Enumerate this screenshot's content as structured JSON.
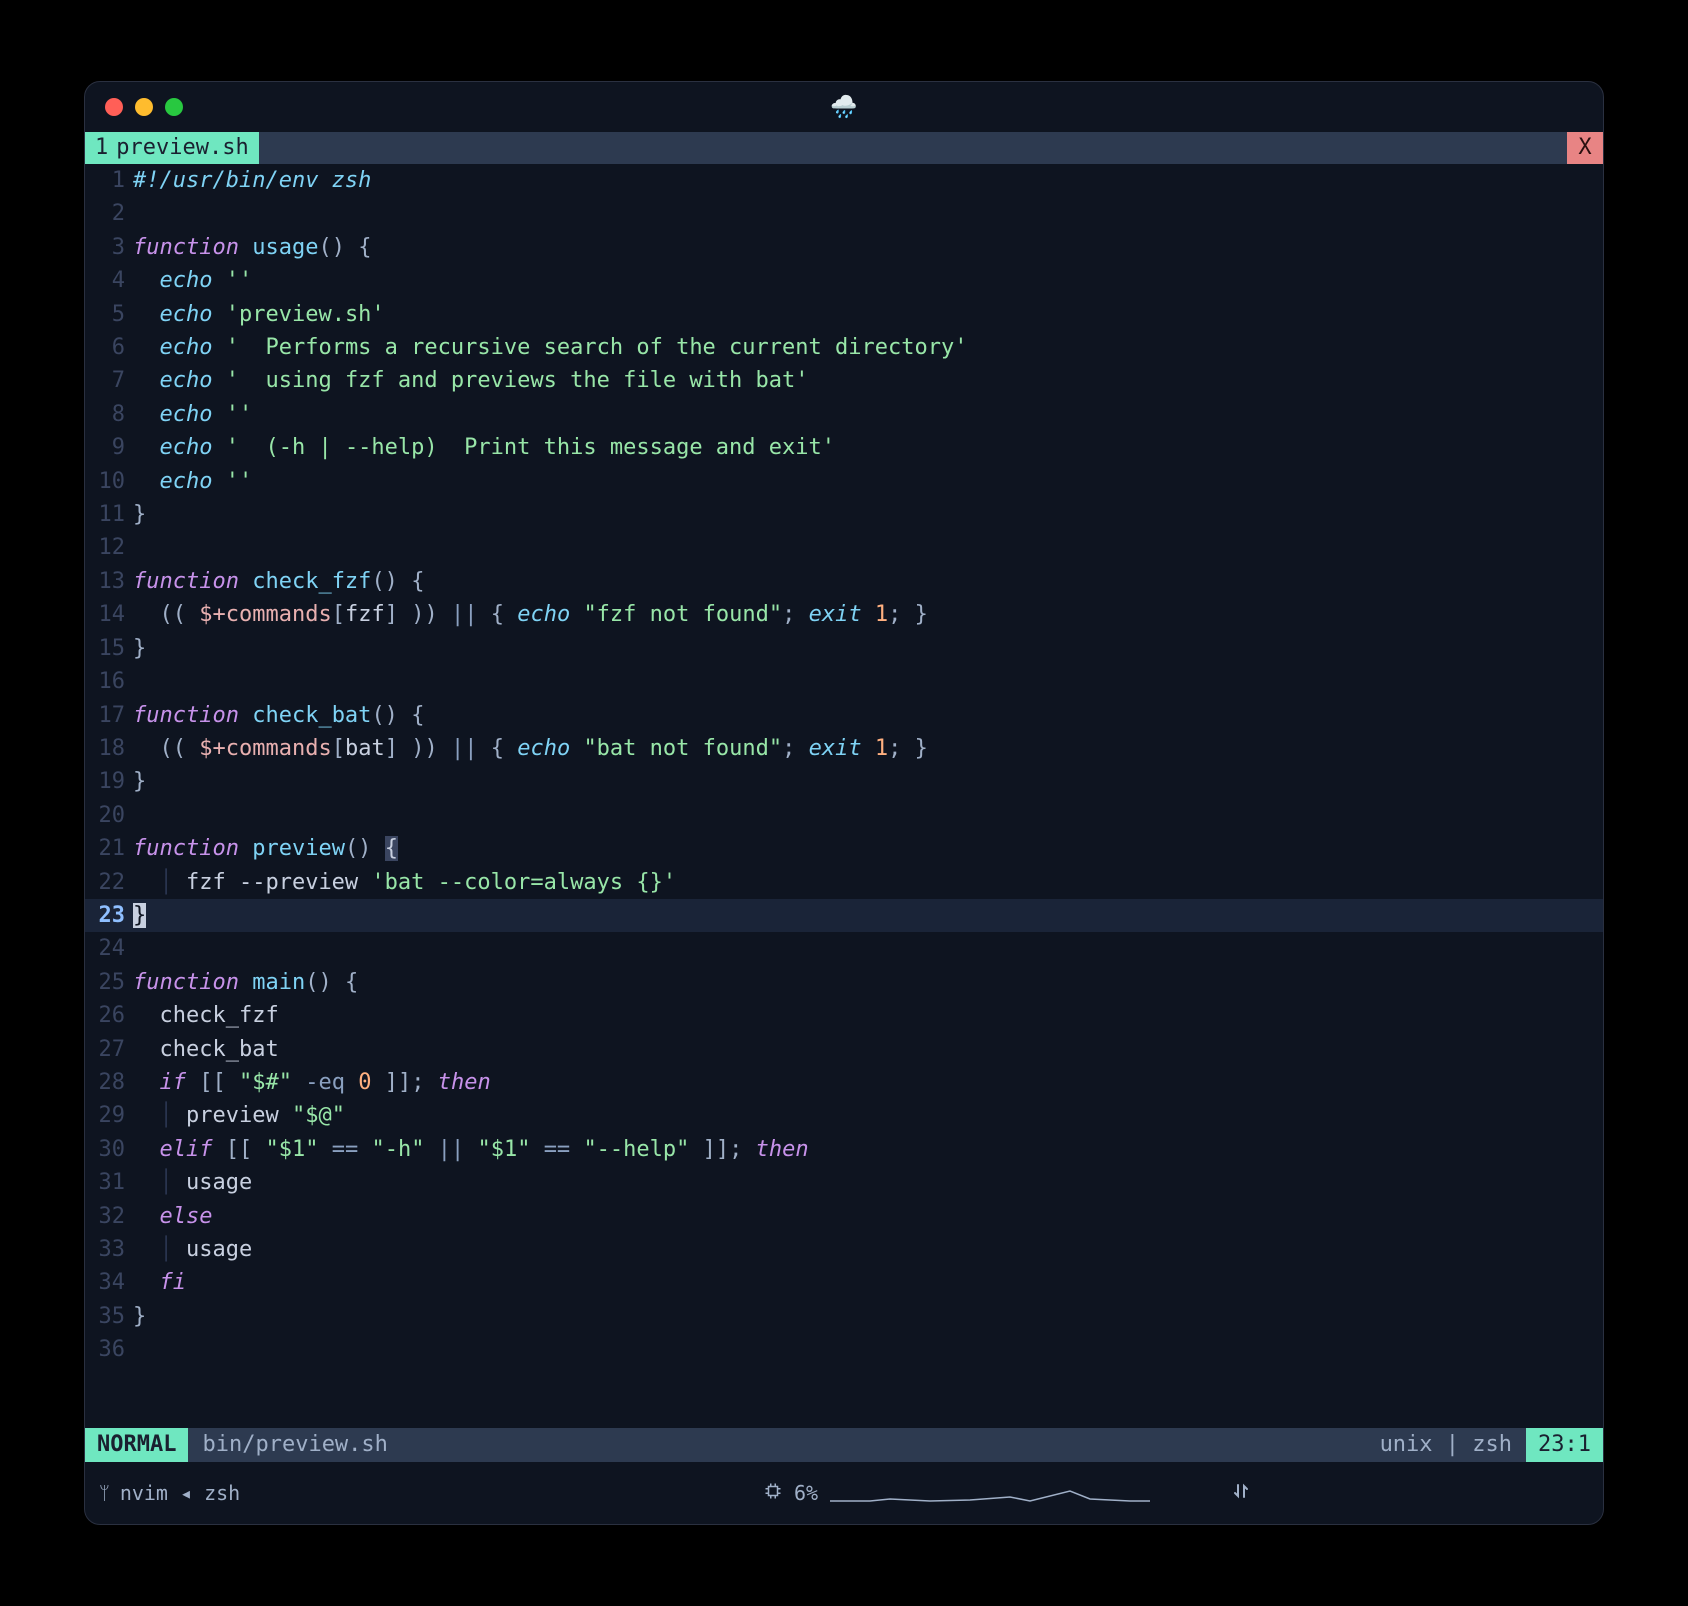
{
  "window": {
    "title_emoji": "🌧️"
  },
  "tabline": {
    "number": "1",
    "filename": "preview.sh",
    "close": "X"
  },
  "lines": [
    {
      "n": "1",
      "segs": [
        [
          "shebang",
          "#!"
        ],
        [
          "shebang",
          "/usr/bin/env zsh"
        ]
      ]
    },
    {
      "n": "2",
      "segs": []
    },
    {
      "n": "3",
      "segs": [
        [
          "keyword",
          "function"
        ],
        [
          "w",
          " "
        ],
        [
          "func",
          "usage"
        ],
        [
          "punct",
          "()"
        ],
        [
          "w",
          " "
        ],
        [
          "punct",
          "{"
        ]
      ]
    },
    {
      "n": "4",
      "segs": [
        [
          "indent",
          "  "
        ],
        [
          "builtin",
          "echo"
        ],
        [
          "w",
          " "
        ],
        [
          "string",
          "''"
        ]
      ]
    },
    {
      "n": "5",
      "segs": [
        [
          "indent",
          "  "
        ],
        [
          "builtin",
          "echo"
        ],
        [
          "w",
          " "
        ],
        [
          "string",
          "'preview.sh'"
        ]
      ]
    },
    {
      "n": "6",
      "segs": [
        [
          "indent",
          "  "
        ],
        [
          "builtin",
          "echo"
        ],
        [
          "w",
          " "
        ],
        [
          "string",
          "'  Performs a recursive search of the current directory'"
        ]
      ]
    },
    {
      "n": "7",
      "segs": [
        [
          "indent",
          "  "
        ],
        [
          "builtin",
          "echo"
        ],
        [
          "w",
          " "
        ],
        [
          "string",
          "'  using fzf and previews the file with bat'"
        ]
      ]
    },
    {
      "n": "8",
      "segs": [
        [
          "indent",
          "  "
        ],
        [
          "builtin",
          "echo"
        ],
        [
          "w",
          " "
        ],
        [
          "string",
          "''"
        ]
      ]
    },
    {
      "n": "9",
      "segs": [
        [
          "indent",
          "  "
        ],
        [
          "builtin",
          "echo"
        ],
        [
          "w",
          " "
        ],
        [
          "string",
          "'  (-h | --help)  Print this message and exit'"
        ]
      ]
    },
    {
      "n": "10",
      "segs": [
        [
          "indent",
          "  "
        ],
        [
          "builtin",
          "echo"
        ],
        [
          "w",
          " "
        ],
        [
          "string",
          "''"
        ]
      ]
    },
    {
      "n": "11",
      "segs": [
        [
          "punct",
          "}"
        ]
      ]
    },
    {
      "n": "12",
      "segs": []
    },
    {
      "n": "13",
      "segs": [
        [
          "keyword",
          "function"
        ],
        [
          "w",
          " "
        ],
        [
          "func",
          "check_fzf"
        ],
        [
          "punct",
          "()"
        ],
        [
          "w",
          " "
        ],
        [
          "punct",
          "{"
        ]
      ]
    },
    {
      "n": "14",
      "segs": [
        [
          "indent",
          "  "
        ],
        [
          "punct",
          "(( "
        ],
        [
          "var",
          "$+commands"
        ],
        [
          "punct",
          "["
        ],
        [
          "plain",
          "fzf"
        ],
        [
          "punct",
          "]"
        ],
        [
          "punct",
          " ))"
        ],
        [
          "w",
          " "
        ],
        [
          "op",
          "||"
        ],
        [
          "w",
          " "
        ],
        [
          "punct",
          "{ "
        ],
        [
          "builtin",
          "echo"
        ],
        [
          "w",
          " "
        ],
        [
          "string",
          "\"fzf not found\""
        ],
        [
          "punct",
          "; "
        ],
        [
          "builtin",
          "exit"
        ],
        [
          "w",
          " "
        ],
        [
          "num",
          "1"
        ],
        [
          "punct",
          "; }"
        ]
      ]
    },
    {
      "n": "15",
      "segs": [
        [
          "punct",
          "}"
        ]
      ]
    },
    {
      "n": "16",
      "segs": []
    },
    {
      "n": "17",
      "segs": [
        [
          "keyword",
          "function"
        ],
        [
          "w",
          " "
        ],
        [
          "func",
          "check_bat"
        ],
        [
          "punct",
          "()"
        ],
        [
          "w",
          " "
        ],
        [
          "punct",
          "{"
        ]
      ]
    },
    {
      "n": "18",
      "segs": [
        [
          "indent",
          "  "
        ],
        [
          "punct",
          "(( "
        ],
        [
          "var",
          "$+commands"
        ],
        [
          "punct",
          "["
        ],
        [
          "plain",
          "bat"
        ],
        [
          "punct",
          "]"
        ],
        [
          "punct",
          " ))"
        ],
        [
          "w",
          " "
        ],
        [
          "op",
          "||"
        ],
        [
          "w",
          " "
        ],
        [
          "punct",
          "{ "
        ],
        [
          "builtin",
          "echo"
        ],
        [
          "w",
          " "
        ],
        [
          "string",
          "\"bat not found\""
        ],
        [
          "punct",
          "; "
        ],
        [
          "builtin",
          "exit"
        ],
        [
          "w",
          " "
        ],
        [
          "num",
          "1"
        ],
        [
          "punct",
          "; }"
        ]
      ]
    },
    {
      "n": "19",
      "segs": [
        [
          "punct",
          "}"
        ]
      ]
    },
    {
      "n": "20",
      "segs": []
    },
    {
      "n": "21",
      "segs": [
        [
          "keyword",
          "function"
        ],
        [
          "w",
          " "
        ],
        [
          "func",
          "preview"
        ],
        [
          "punct",
          "()"
        ],
        [
          "w",
          " "
        ],
        [
          "match",
          "{"
        ]
      ]
    },
    {
      "n": "22",
      "segs": [
        [
          "indent",
          "  │ "
        ],
        [
          "plain",
          "fzf "
        ],
        [
          "plain",
          "--preview "
        ],
        [
          "string",
          "'bat --color=always {}'"
        ]
      ]
    },
    {
      "n": "23",
      "active": true,
      "segs": [
        [
          "cursor",
          "}"
        ]
      ]
    },
    {
      "n": "24",
      "segs": []
    },
    {
      "n": "25",
      "segs": [
        [
          "keyword",
          "function"
        ],
        [
          "w",
          " "
        ],
        [
          "func",
          "main"
        ],
        [
          "punct",
          "()"
        ],
        [
          "w",
          " "
        ],
        [
          "punct",
          "{"
        ]
      ]
    },
    {
      "n": "26",
      "segs": [
        [
          "indent",
          "  "
        ],
        [
          "plain",
          "check_fzf"
        ]
      ]
    },
    {
      "n": "27",
      "segs": [
        [
          "indent",
          "  "
        ],
        [
          "plain",
          "check_bat"
        ]
      ]
    },
    {
      "n": "28",
      "segs": [
        [
          "indent",
          "  "
        ],
        [
          "keyword",
          "if"
        ],
        [
          "w",
          " "
        ],
        [
          "punct",
          "[[ "
        ],
        [
          "string",
          "\"$#\""
        ],
        [
          "w",
          " "
        ],
        [
          "op",
          "-eq"
        ],
        [
          "w",
          " "
        ],
        [
          "num",
          "0"
        ],
        [
          "punct",
          " ]]"
        ],
        [
          "punct",
          "; "
        ],
        [
          "keyword",
          "then"
        ]
      ]
    },
    {
      "n": "29",
      "segs": [
        [
          "indent",
          "  │ "
        ],
        [
          "plain",
          "preview "
        ],
        [
          "string",
          "\"$@\""
        ]
      ]
    },
    {
      "n": "30",
      "segs": [
        [
          "indent",
          "  "
        ],
        [
          "keyword",
          "elif"
        ],
        [
          "w",
          " "
        ],
        [
          "punct",
          "[[ "
        ],
        [
          "string",
          "\"$1\""
        ],
        [
          "w",
          " "
        ],
        [
          "op",
          "=="
        ],
        [
          "w",
          " "
        ],
        [
          "string",
          "\"-h\""
        ],
        [
          "w",
          " "
        ],
        [
          "op",
          "||"
        ],
        [
          "w",
          " "
        ],
        [
          "string",
          "\"$1\""
        ],
        [
          "w",
          " "
        ],
        [
          "op",
          "=="
        ],
        [
          "w",
          " "
        ],
        [
          "string",
          "\"--help\""
        ],
        [
          "punct",
          " ]]"
        ],
        [
          "punct",
          "; "
        ],
        [
          "keyword",
          "then"
        ]
      ]
    },
    {
      "n": "31",
      "segs": [
        [
          "indent",
          "  │ "
        ],
        [
          "plain",
          "usage"
        ]
      ]
    },
    {
      "n": "32",
      "segs": [
        [
          "indent",
          "  "
        ],
        [
          "keyword",
          "else"
        ]
      ]
    },
    {
      "n": "33",
      "segs": [
        [
          "indent",
          "  │ "
        ],
        [
          "plain",
          "usage"
        ]
      ]
    },
    {
      "n": "34",
      "segs": [
        [
          "indent",
          "  "
        ],
        [
          "keyword",
          "fi"
        ]
      ]
    },
    {
      "n": "35",
      "segs": [
        [
          "punct",
          "}"
        ]
      ]
    },
    {
      "n": "36",
      "segs": []
    }
  ],
  "statusline": {
    "mode": " NORMAL ",
    "file": "bin/preview.sh",
    "info": "unix |  zsh ",
    "pos": " 23:1 "
  },
  "tmux": {
    "left_icon": "ᛘ",
    "session": "nvim ◂ zsh",
    "cpu_icon": "▢",
    "cpu": "6%",
    "net_icon": "⇅"
  }
}
